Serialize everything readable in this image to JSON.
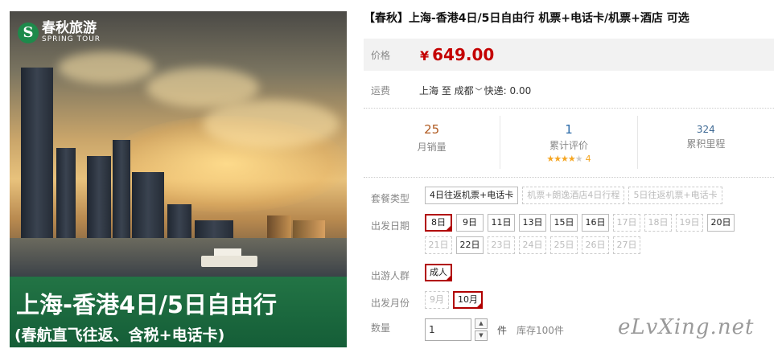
{
  "logo": {
    "cn": "春秋旅游",
    "en": "SPRING TOUR",
    "mark": "S"
  },
  "hero": {
    "title": "上海-香港4日/5日自由行",
    "subtitle": "(春航直飞往返、含税+电话卡)"
  },
  "product": {
    "title": "【春秋】上海-香港4日/5日自由行 机票+电话卡/机票+酒店 可选",
    "price_label": "价格",
    "currency": "¥",
    "price": "649.00"
  },
  "shipping": {
    "label": "运费",
    "text": "上海 至 成都",
    "express": "快递: 0.00"
  },
  "stats": {
    "monthly_sales": "25",
    "monthly_sales_label": "月销量",
    "reviews": "1",
    "reviews_label": "累计评价",
    "rating_stars": 4,
    "rating_count": "4",
    "points": "324",
    "points_label": "累积里程"
  },
  "package": {
    "label": "套餐类型",
    "options": [
      "4日往返机票+电话卡",
      "机票+朗逸酒店4日行程",
      "5日往返机票+电话卡"
    ]
  },
  "dates": {
    "label": "出发日期",
    "options": [
      "8日",
      "9日",
      "11日",
      "13日",
      "15日",
      "16日",
      "17日",
      "18日",
      "19日",
      "20日",
      "21日",
      "22日",
      "23日",
      "24日",
      "25日",
      "26日",
      "27日"
    ]
  },
  "travelers": {
    "label": "出游人群",
    "options": [
      "成人"
    ]
  },
  "month": {
    "label": "出发月份",
    "options": [
      "9月",
      "10月"
    ]
  },
  "quantity": {
    "label": "数量",
    "value": "1",
    "unit": "件",
    "stock": "库存100件"
  },
  "watermark": "eLvXing.net",
  "colors": {
    "price": "#c40000",
    "selected": "#b10000",
    "banner": "#1e7846"
  }
}
